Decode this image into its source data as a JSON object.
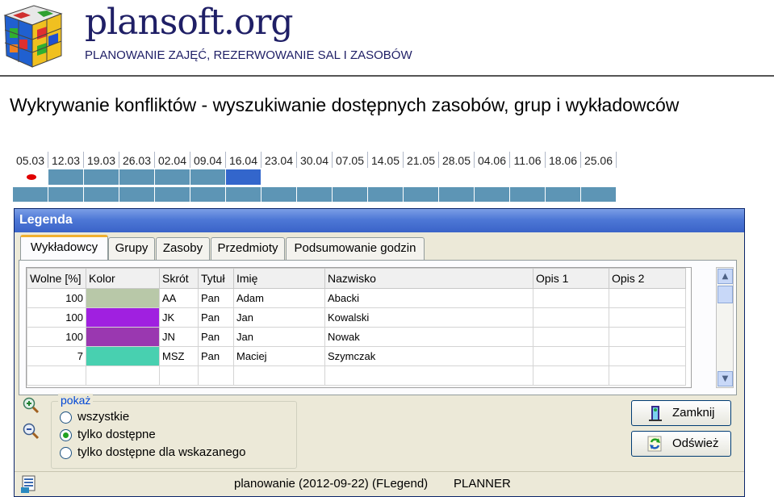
{
  "header": {
    "brand": "plansoft.org",
    "subtitle": "PLANOWANIE ZAJĘĆ, REZERWOWANIE SAL I ZASOBÓW",
    "slide_title": "Wykrywanie konfliktów  - wyszukiwanie dostępnych zasobów, grup i wykładowców"
  },
  "calendar": {
    "dates": [
      "05.03",
      "12.03",
      "19.03",
      "26.03",
      "02.04",
      "09.04",
      "16.04",
      "23.04",
      "30.04",
      "07.05",
      "14.05",
      "21.05",
      "28.05",
      "04.06",
      "11.06",
      "18.06",
      "25.06"
    ],
    "row1_filled": 7,
    "row1_highlight_index": 6,
    "row2_filled": 17,
    "colors": {
      "cell": "#5d95b5",
      "highlight": "#3366cc",
      "marker": "#e00000"
    }
  },
  "window": {
    "title": "Legenda",
    "tabs": [
      {
        "label": "Wykładowcy",
        "active": true
      },
      {
        "label": "Grupy",
        "active": false
      },
      {
        "label": "Zasoby",
        "active": false
      },
      {
        "label": "Przedmioty",
        "active": false
      },
      {
        "label": "Podsumowanie godzin",
        "active": false
      }
    ],
    "table": {
      "columns": [
        "Wolne [%]",
        "Kolor",
        "Skrót",
        "Tytuł",
        "Imię",
        "Nazwisko",
        "Opis 1",
        "Opis 2"
      ],
      "rows": [
        {
          "wolne": "100",
          "kolor": "#b8c8a8",
          "skrot": "AA",
          "tytul": "Pan",
          "imie": "Adam",
          "nazwisko": "Abacki",
          "opis1": "",
          "opis2": ""
        },
        {
          "wolne": "100",
          "kolor": "#a020e0",
          "skrot": "JK",
          "tytul": "Pan",
          "imie": "Jan",
          "nazwisko": "Kowalski",
          "opis1": "",
          "opis2": ""
        },
        {
          "wolne": "100",
          "kolor": "#9a38b0",
          "skrot": "JN",
          "tytul": "Pan",
          "imie": "Jan",
          "nazwisko": "Nowak",
          "opis1": "",
          "opis2": ""
        },
        {
          "wolne": "7",
          "kolor": "#48d0b0",
          "skrot": "MSZ",
          "tytul": "Pan",
          "imie": "Maciej",
          "nazwisko": "Szymczak",
          "opis1": "",
          "opis2": ""
        }
      ]
    },
    "filter": {
      "label": "pokaż",
      "options": [
        {
          "label": "wszystkie",
          "selected": false
        },
        {
          "label": "tylko dostępne",
          "selected": true
        },
        {
          "label": "tylko dostępne dla wskazanego",
          "selected": false
        }
      ]
    },
    "buttons": {
      "close": "Zamknij",
      "refresh": "Odśwież"
    },
    "status": {
      "text": "planowanie (2012-09-22) (FLegend)",
      "user": "PLANNER"
    }
  }
}
